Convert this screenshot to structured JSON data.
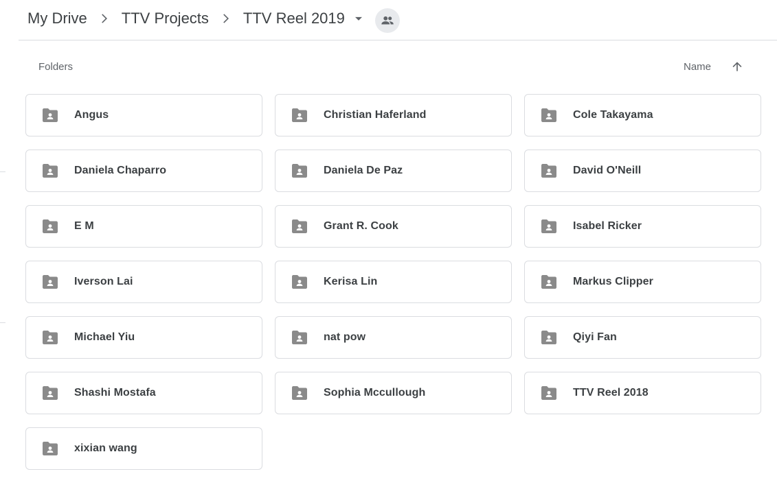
{
  "breadcrumb": {
    "items": [
      {
        "label": "My Drive"
      },
      {
        "label": "TTV Projects"
      },
      {
        "label": "TTV Reel 2019"
      }
    ],
    "current_icon": "shared-folder-people-icon"
  },
  "section": {
    "label": "Folders",
    "sort_label": "Name",
    "sort_direction": "ascending"
  },
  "colors": {
    "folder_icon": "#8a8a8a",
    "border": "#dadce0",
    "text": "#3c4043"
  },
  "folders": [
    {
      "name": "Angus"
    },
    {
      "name": "Christian Haferland"
    },
    {
      "name": "Cole Takayama"
    },
    {
      "name": "Daniela Chaparro"
    },
    {
      "name": "Daniela De Paz"
    },
    {
      "name": "David O'Neill"
    },
    {
      "name": "E M"
    },
    {
      "name": "Grant R. Cook"
    },
    {
      "name": "Isabel Ricker"
    },
    {
      "name": "Iverson Lai"
    },
    {
      "name": "Kerisa Lin"
    },
    {
      "name": "Markus Clipper"
    },
    {
      "name": "Michael Yiu"
    },
    {
      "name": "nat pow"
    },
    {
      "name": "Qiyi Fan"
    },
    {
      "name": "Shashi Mostafa"
    },
    {
      "name": "Sophia Mccullough"
    },
    {
      "name": "TTV Reel 2018"
    },
    {
      "name": "xixian wang"
    }
  ]
}
